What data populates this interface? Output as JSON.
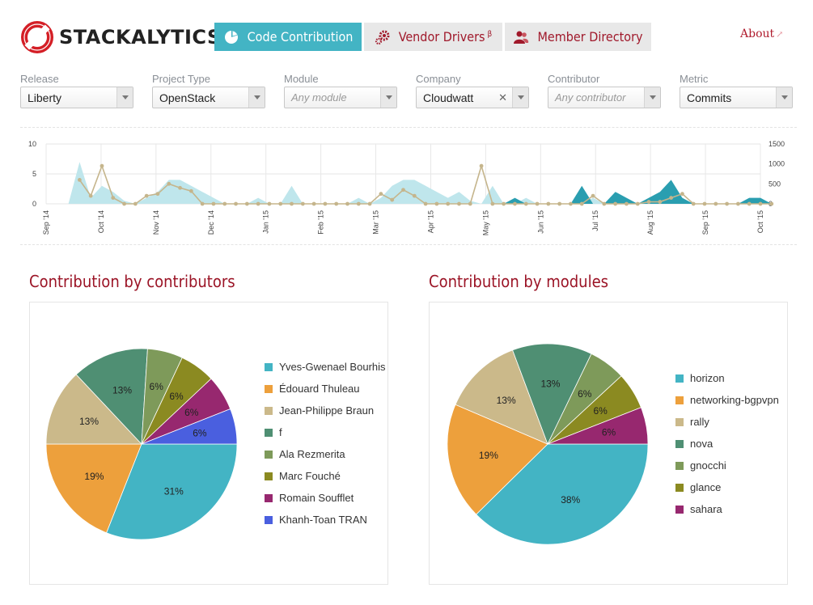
{
  "brand": {
    "name": "STACKALYTICS"
  },
  "nav": {
    "tabs": [
      {
        "label": "Code Contribution",
        "active": true,
        "icon": "pie-chart-icon"
      },
      {
        "label": "Vendor Drivers",
        "sup": "β",
        "active": false,
        "icon": "gears-icon"
      },
      {
        "label": "Member Directory",
        "active": false,
        "icon": "people-icon"
      }
    ],
    "about": "About"
  },
  "filters": [
    {
      "label": "Release",
      "value": "Liberty",
      "placeholder": ""
    },
    {
      "label": "Project Type",
      "value": "OpenStack",
      "placeholder": ""
    },
    {
      "label": "Module",
      "value": "",
      "placeholder": "Any module"
    },
    {
      "label": "Company",
      "value": "Cloudwatt",
      "placeholder": "",
      "clearable": true
    },
    {
      "label": "Contributor",
      "value": "",
      "placeholder": "Any contributor"
    },
    {
      "label": "Metric",
      "value": "Commits",
      "placeholder": ""
    }
  ],
  "colors": {
    "accent": "#43b4c4",
    "brand_red": "#9b1426",
    "area_light": "#bfe6ec",
    "area_dark": "#2a9eb0",
    "line": "#c5b58c"
  },
  "chart_data": [
    {
      "type": "area",
      "title": "",
      "x_ticks": [
        "Sep '14",
        "Oct '14",
        "Nov '14",
        "Dec '14",
        "Jan '15",
        "Feb '15",
        "Mar '15",
        "Apr '15",
        "May '15",
        "Jun '15",
        "Jul '15",
        "Aug '15",
        "Sep '15",
        "Oct '15"
      ],
      "y_left_ticks": [
        0,
        5,
        10
      ],
      "y_right_ticks": [
        0,
        500,
        1000,
        1500
      ],
      "ylim_left": [
        0,
        10
      ],
      "ylim_right": [
        0,
        1500
      ],
      "series": [
        {
          "values": [
            0,
            0,
            0,
            7,
            1,
            3,
            2,
            0.5,
            0,
            1,
            2,
            4,
            4,
            3,
            2,
            1,
            0,
            0,
            0,
            1,
            0,
            0,
            3,
            0,
            0,
            0,
            0,
            0,
            1,
            0,
            1,
            3,
            4,
            4,
            3,
            2,
            1,
            2,
            0.5,
            0,
            3,
            0,
            0,
            1,
            0,
            0,
            0,
            0,
            0,
            1,
            0,
            0,
            0,
            0,
            0,
            0,
            0,
            0,
            0,
            0,
            0,
            0,
            0,
            0,
            0
          ]
        },
        {
          "values": [
            0,
            0,
            0,
            0,
            0,
            0,
            0,
            0,
            0,
            0,
            0,
            0,
            0,
            0,
            0,
            0,
            0,
            0,
            0,
            0,
            0,
            0,
            0,
            0,
            0,
            0,
            0,
            0,
            0,
            0,
            0,
            0,
            0,
            0,
            0,
            0,
            0,
            0,
            0,
            0,
            0,
            0,
            1,
            0,
            0,
            0,
            0,
            0,
            3,
            0,
            0,
            2,
            1,
            0,
            1,
            2,
            4,
            1,
            0,
            0,
            0,
            0,
            0,
            1,
            1,
            0
          ]
        },
        {
          "values": [
            null,
            null,
            null,
            600,
            200,
            950,
            150,
            0,
            0,
            200,
            250,
            500,
            400,
            320,
            0,
            0,
            0,
            0,
            0,
            0,
            0,
            0,
            0,
            0,
            0,
            0,
            0,
            0,
            0,
            0,
            250,
            100,
            350,
            200,
            0,
            0,
            0,
            0,
            0,
            950,
            0,
            0,
            0,
            0,
            0,
            0,
            0,
            0,
            0,
            200,
            0,
            0,
            0,
            0,
            50,
            50,
            150,
            250,
            0,
            0,
            0,
            0,
            0,
            0,
            0,
            0
          ]
        }
      ]
    },
    {
      "type": "pie",
      "title": "Contribution by contributors",
      "categories": [
        "Yves-Gwenael Bourhis",
        "Édouard Thuleau",
        "Jean-Philippe Braun",
        "f",
        "Ala Rezmerita",
        "Marc Fouché",
        "Romain Soufflet",
        "Khanh-Toan TRAN"
      ],
      "values": [
        31,
        19,
        13,
        13,
        6,
        6,
        6,
        6
      ],
      "labels": [
        "31%",
        "19%",
        "13%",
        "13%",
        "6%",
        "6%",
        "6%",
        "6%"
      ],
      "colors": [
        "#43b4c4",
        "#eda03c",
        "#cbb98a",
        "#4f8f73",
        "#7e9a5a",
        "#8b8a21",
        "#97286f",
        "#4a5fdf"
      ]
    },
    {
      "type": "pie",
      "title": "Contribution by modules",
      "categories": [
        "horizon",
        "networking-bgpvpn",
        "rally",
        "nova",
        "gnocchi",
        "glance",
        "sahara"
      ],
      "values": [
        38,
        19,
        13,
        13,
        6,
        6,
        6
      ],
      "labels": [
        "38%",
        "19%",
        "13%",
        "13%",
        "6%",
        "6%",
        "6%"
      ],
      "colors": [
        "#43b4c4",
        "#eda03c",
        "#cbb98a",
        "#4f8f73",
        "#7e9a5a",
        "#8b8a21",
        "#97286f"
      ]
    }
  ]
}
